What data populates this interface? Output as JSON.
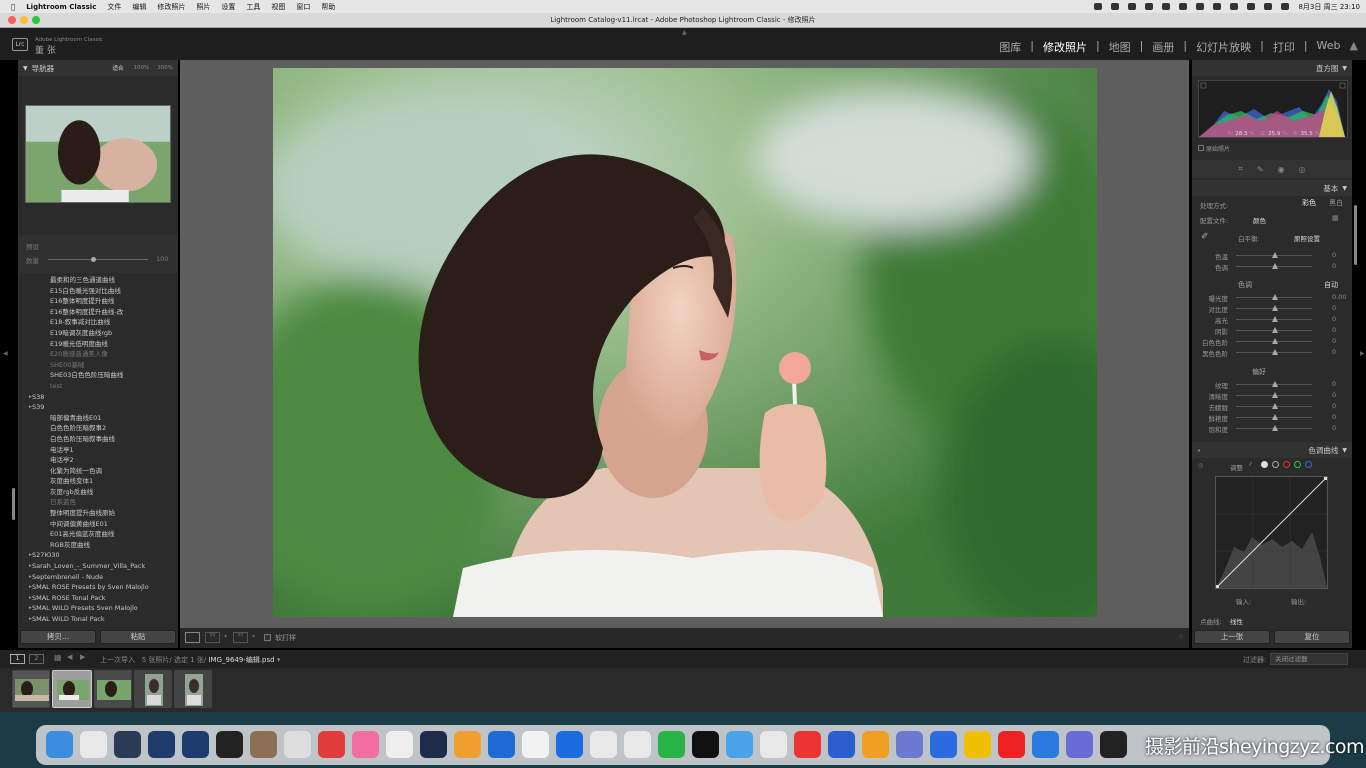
{
  "menubar": {
    "app": "Lightroom Classic",
    "items": [
      "文件",
      "编辑",
      "修改照片",
      "照片",
      "设置",
      "工具",
      "视图",
      "窗口",
      "帮助"
    ],
    "clock": "8月3日 周三 23:10"
  },
  "window": {
    "title": "Lightroom Catalog-v11.lrcat - Adobe Photoshop Lightroom Classic - 修改照片"
  },
  "identity": {
    "badge": "Lrc",
    "line1": "Adobe Lightroom Classic",
    "line2": "董 张"
  },
  "modules": [
    "图库",
    "修改照片",
    "地图",
    "画册",
    "幻灯片放映",
    "打印",
    "Web"
  ],
  "active_module": "修改照片",
  "navigator": {
    "title": "导航器",
    "zoom": [
      "适合",
      "100%",
      "300%"
    ]
  },
  "presets_panel": {
    "title": "预设",
    "amount_label": "数量",
    "amount_value": "100"
  },
  "presets": [
    {
      "t": "p",
      "name": "最柔和的三色通道曲线"
    },
    {
      "t": "p",
      "name": "E15白色暖光强对比曲线"
    },
    {
      "t": "p",
      "name": "E16整体明度提升曲线"
    },
    {
      "t": "p",
      "name": "E16整体明度提升曲线-改"
    },
    {
      "t": "p",
      "name": "E18-叙事减对比曲线"
    },
    {
      "t": "p",
      "name": "E19暗调灰度曲线rgb"
    },
    {
      "t": "p",
      "name": "E19暖光低明度曲线"
    },
    {
      "t": "p",
      "name": "E20质感普通美人像",
      "dim": true
    },
    {
      "t": "p",
      "name": "SHE00基础",
      "dim": true
    },
    {
      "t": "p",
      "name": "SHE03白色色阶压暗曲线"
    },
    {
      "t": "p",
      "name": "test",
      "dim": true
    },
    {
      "t": "f",
      "name": "S38"
    },
    {
      "t": "f",
      "name": "S39"
    },
    {
      "t": "p",
      "name": "暗部偏青曲线E01"
    },
    {
      "t": "p",
      "name": "白色色阶压暗叙事2"
    },
    {
      "t": "p",
      "name": "白色色阶压暗叙事曲线"
    },
    {
      "t": "p",
      "name": "电话亭1"
    },
    {
      "t": "p",
      "name": "电话亭2"
    },
    {
      "t": "p",
      "name": "化繁为简统一色调"
    },
    {
      "t": "p",
      "name": "灰度曲线变体1"
    },
    {
      "t": "p",
      "name": "灰度rgb反曲线"
    },
    {
      "t": "p",
      "name": "日系蓝色",
      "dim": true
    },
    {
      "t": "p",
      "name": "整体明度提升曲线原始"
    },
    {
      "t": "p",
      "name": "中间调偏黄曲线E01"
    },
    {
      "t": "p",
      "name": "E01高光偏蓝灰度曲线"
    },
    {
      "t": "p",
      "name": "RGB灰度曲线"
    },
    {
      "t": "f",
      "name": "S27Ю30"
    },
    {
      "t": "f",
      "name": "Sarah_Loven_-_Summer_Villa_Pack"
    },
    {
      "t": "f",
      "name": "Septembrenell - Nude"
    },
    {
      "t": "f",
      "name": "SMAL ROSE Presets by Sven Malojlo"
    },
    {
      "t": "f",
      "name": "SMAL ROSE Tonal Pack"
    },
    {
      "t": "f",
      "name": "SMAL WILD Presets Sven Malojlo"
    },
    {
      "t": "f",
      "name": "SMAL WILD Tonal Pack"
    }
  ],
  "left_buttons": {
    "copy": "拷贝...",
    "paste": "粘贴"
  },
  "toolbar": {
    "softproof": "软打样"
  },
  "histogram": {
    "title": "直方图",
    "readout": {
      "r_label": "R",
      "r": "28.3",
      "g_label": "G",
      "g": "25.9",
      "b_label": "B",
      "b": "35.5",
      "pct": "%"
    },
    "original": "原始照片"
  },
  "basic": {
    "title": "基本",
    "treatment_label": "处理方式:",
    "treatment_color": "彩色",
    "treatment_bw": "黑白",
    "profile_label": "配置文件:",
    "profile_value": "颜色",
    "wb_label": "白平衡:",
    "wb_value": "原照设置",
    "tone_label": "色调",
    "auto": "自动",
    "presence_label": "偏好",
    "sliders_wb": [
      {
        "label": "色温",
        "value": "0"
      },
      {
        "label": "色调",
        "value": "0"
      }
    ],
    "sliders_tone": [
      {
        "label": "曝光度",
        "value": "0.00"
      },
      {
        "label": "对比度",
        "value": "0"
      },
      {
        "label": "高光",
        "value": "0"
      },
      {
        "label": "阴影",
        "value": "0"
      },
      {
        "label": "白色色阶",
        "value": "0"
      },
      {
        "label": "黑色色阶",
        "value": "0"
      }
    ],
    "sliders_presence": [
      {
        "label": "纹理",
        "value": "0"
      },
      {
        "label": "清晰度",
        "value": "0"
      },
      {
        "label": "去朦胧",
        "value": "0"
      },
      {
        "label": "鲜艳度",
        "value": "0"
      },
      {
        "label": "饱和度",
        "value": "0"
      }
    ]
  },
  "tone_curve": {
    "title": "色调曲线",
    "adjust": "调整",
    "input": "输入:",
    "output": "输出:",
    "point_curve": "点曲线:",
    "point_value": "线性"
  },
  "right_buttons": {
    "previous": "上一张",
    "reset": "复位"
  },
  "filmstrip_bar": {
    "source": "上一次导入",
    "count": "5 张照片/",
    "selected": "选定 1 张/",
    "filename": "IMG_9649-编辑.psd",
    "filter_label": "过滤器:",
    "filter_value": "关闭过滤器"
  },
  "watermark": "摄影前沿sheyingzyz.com",
  "colors": {
    "panel": "#2b2b2b",
    "center": "#5e5e5e",
    "accent": "#f0f0f0"
  }
}
